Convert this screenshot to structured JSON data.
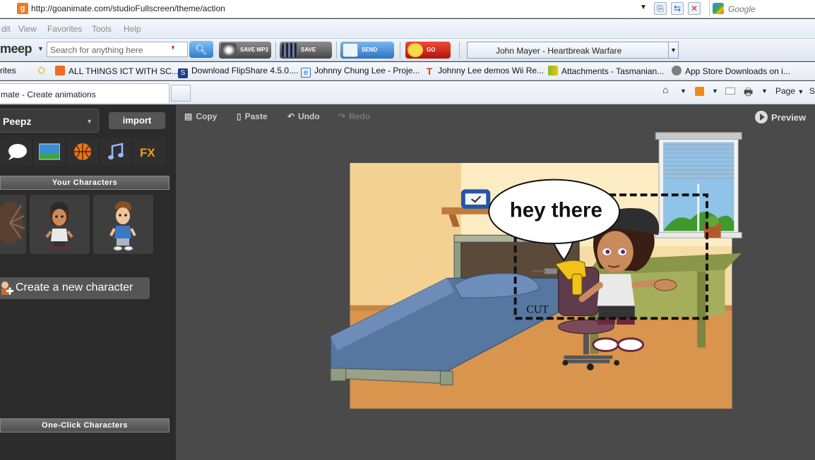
{
  "browser": {
    "url": "http://goanimate.com/studioFullscreen/theme/action",
    "search_placeholder": "Google",
    "menu": [
      "dit",
      "View",
      "Favorites",
      "Tools",
      "Help"
    ],
    "meep": {
      "logo": "meep",
      "search_placeholder": "Search for anything here",
      "save_mp3": "SAVE MP3",
      "save_video": "SAVE VIDEO",
      "send_this": "SEND THIS",
      "go_pro": "GO PRO",
      "now_playing": "John Mayer - Heartbreak Warfare"
    },
    "favorites": {
      "label": "rites",
      "items": [
        "ALL THINGS ICT WITH SC...",
        "Download FlipShare 4.5.0....",
        "Johnny Chung Lee - Proje...",
        "Johnny Lee demos Wii Re...",
        "Attachments - Tasmanian...",
        "App Store Downloads on i..."
      ]
    },
    "tab": {
      "title": "mate - Create animations"
    },
    "commands": {
      "page": "Page",
      "more": "S"
    }
  },
  "studio": {
    "theme": "Peepz",
    "import_label": "import",
    "your_characters": "Your Characters",
    "create_character": "Create a new character",
    "one_click": "One-Click Characters",
    "toolbar": {
      "copy": "Copy",
      "paste": "Paste",
      "undo": "Undo",
      "redo": "Redo",
      "preview": "Preview"
    },
    "scene": {
      "bubble_text": "hey there",
      "cut_label": "CUT"
    }
  }
}
